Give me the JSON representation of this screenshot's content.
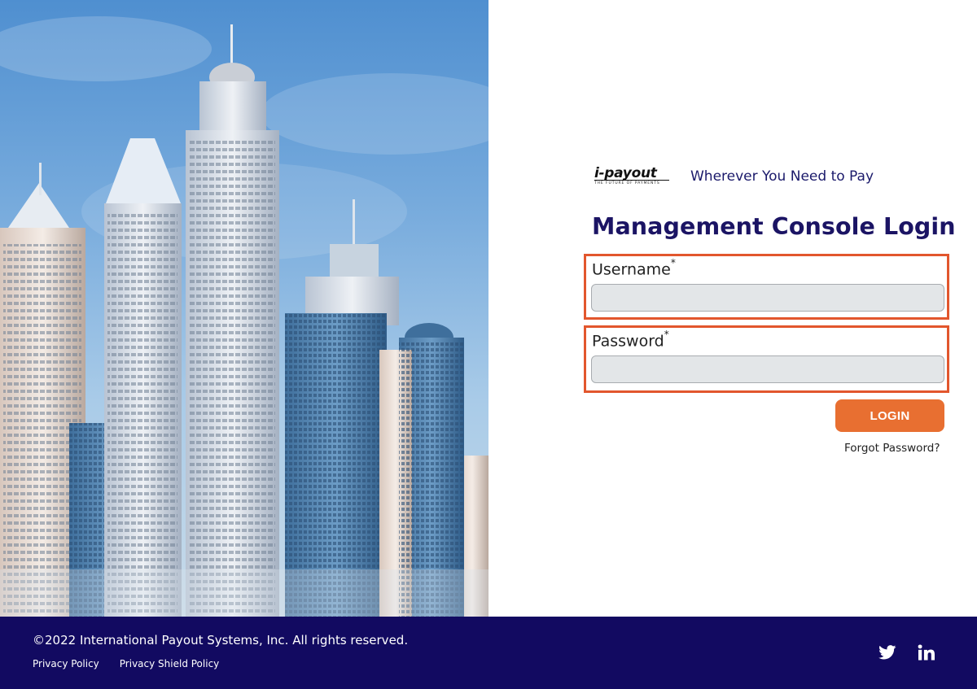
{
  "brand": {
    "logo_text": "i-payout",
    "logo_subtext": "THE FUTURE OF PAYMENTS",
    "tagline": "Wherever You Need to Pay"
  },
  "login": {
    "title": "Management Console Login",
    "username_label": "Username",
    "password_label": "Password",
    "required_mark": "*",
    "username_value": "",
    "password_value": "",
    "login_button": "LOGIN",
    "forgot_password": "Forgot Password?"
  },
  "footer": {
    "copyright": "©2022 International Payout Systems, Inc. All rights reserved.",
    "links": [
      "Privacy Policy",
      "Privacy Shield Policy"
    ],
    "social": [
      "twitter-icon",
      "linkedin-icon"
    ]
  },
  "colors": {
    "footer_bg": "#120a61",
    "title": "#1b1464",
    "accent_orange": "#e86f31",
    "highlight_border": "#e2562d"
  }
}
